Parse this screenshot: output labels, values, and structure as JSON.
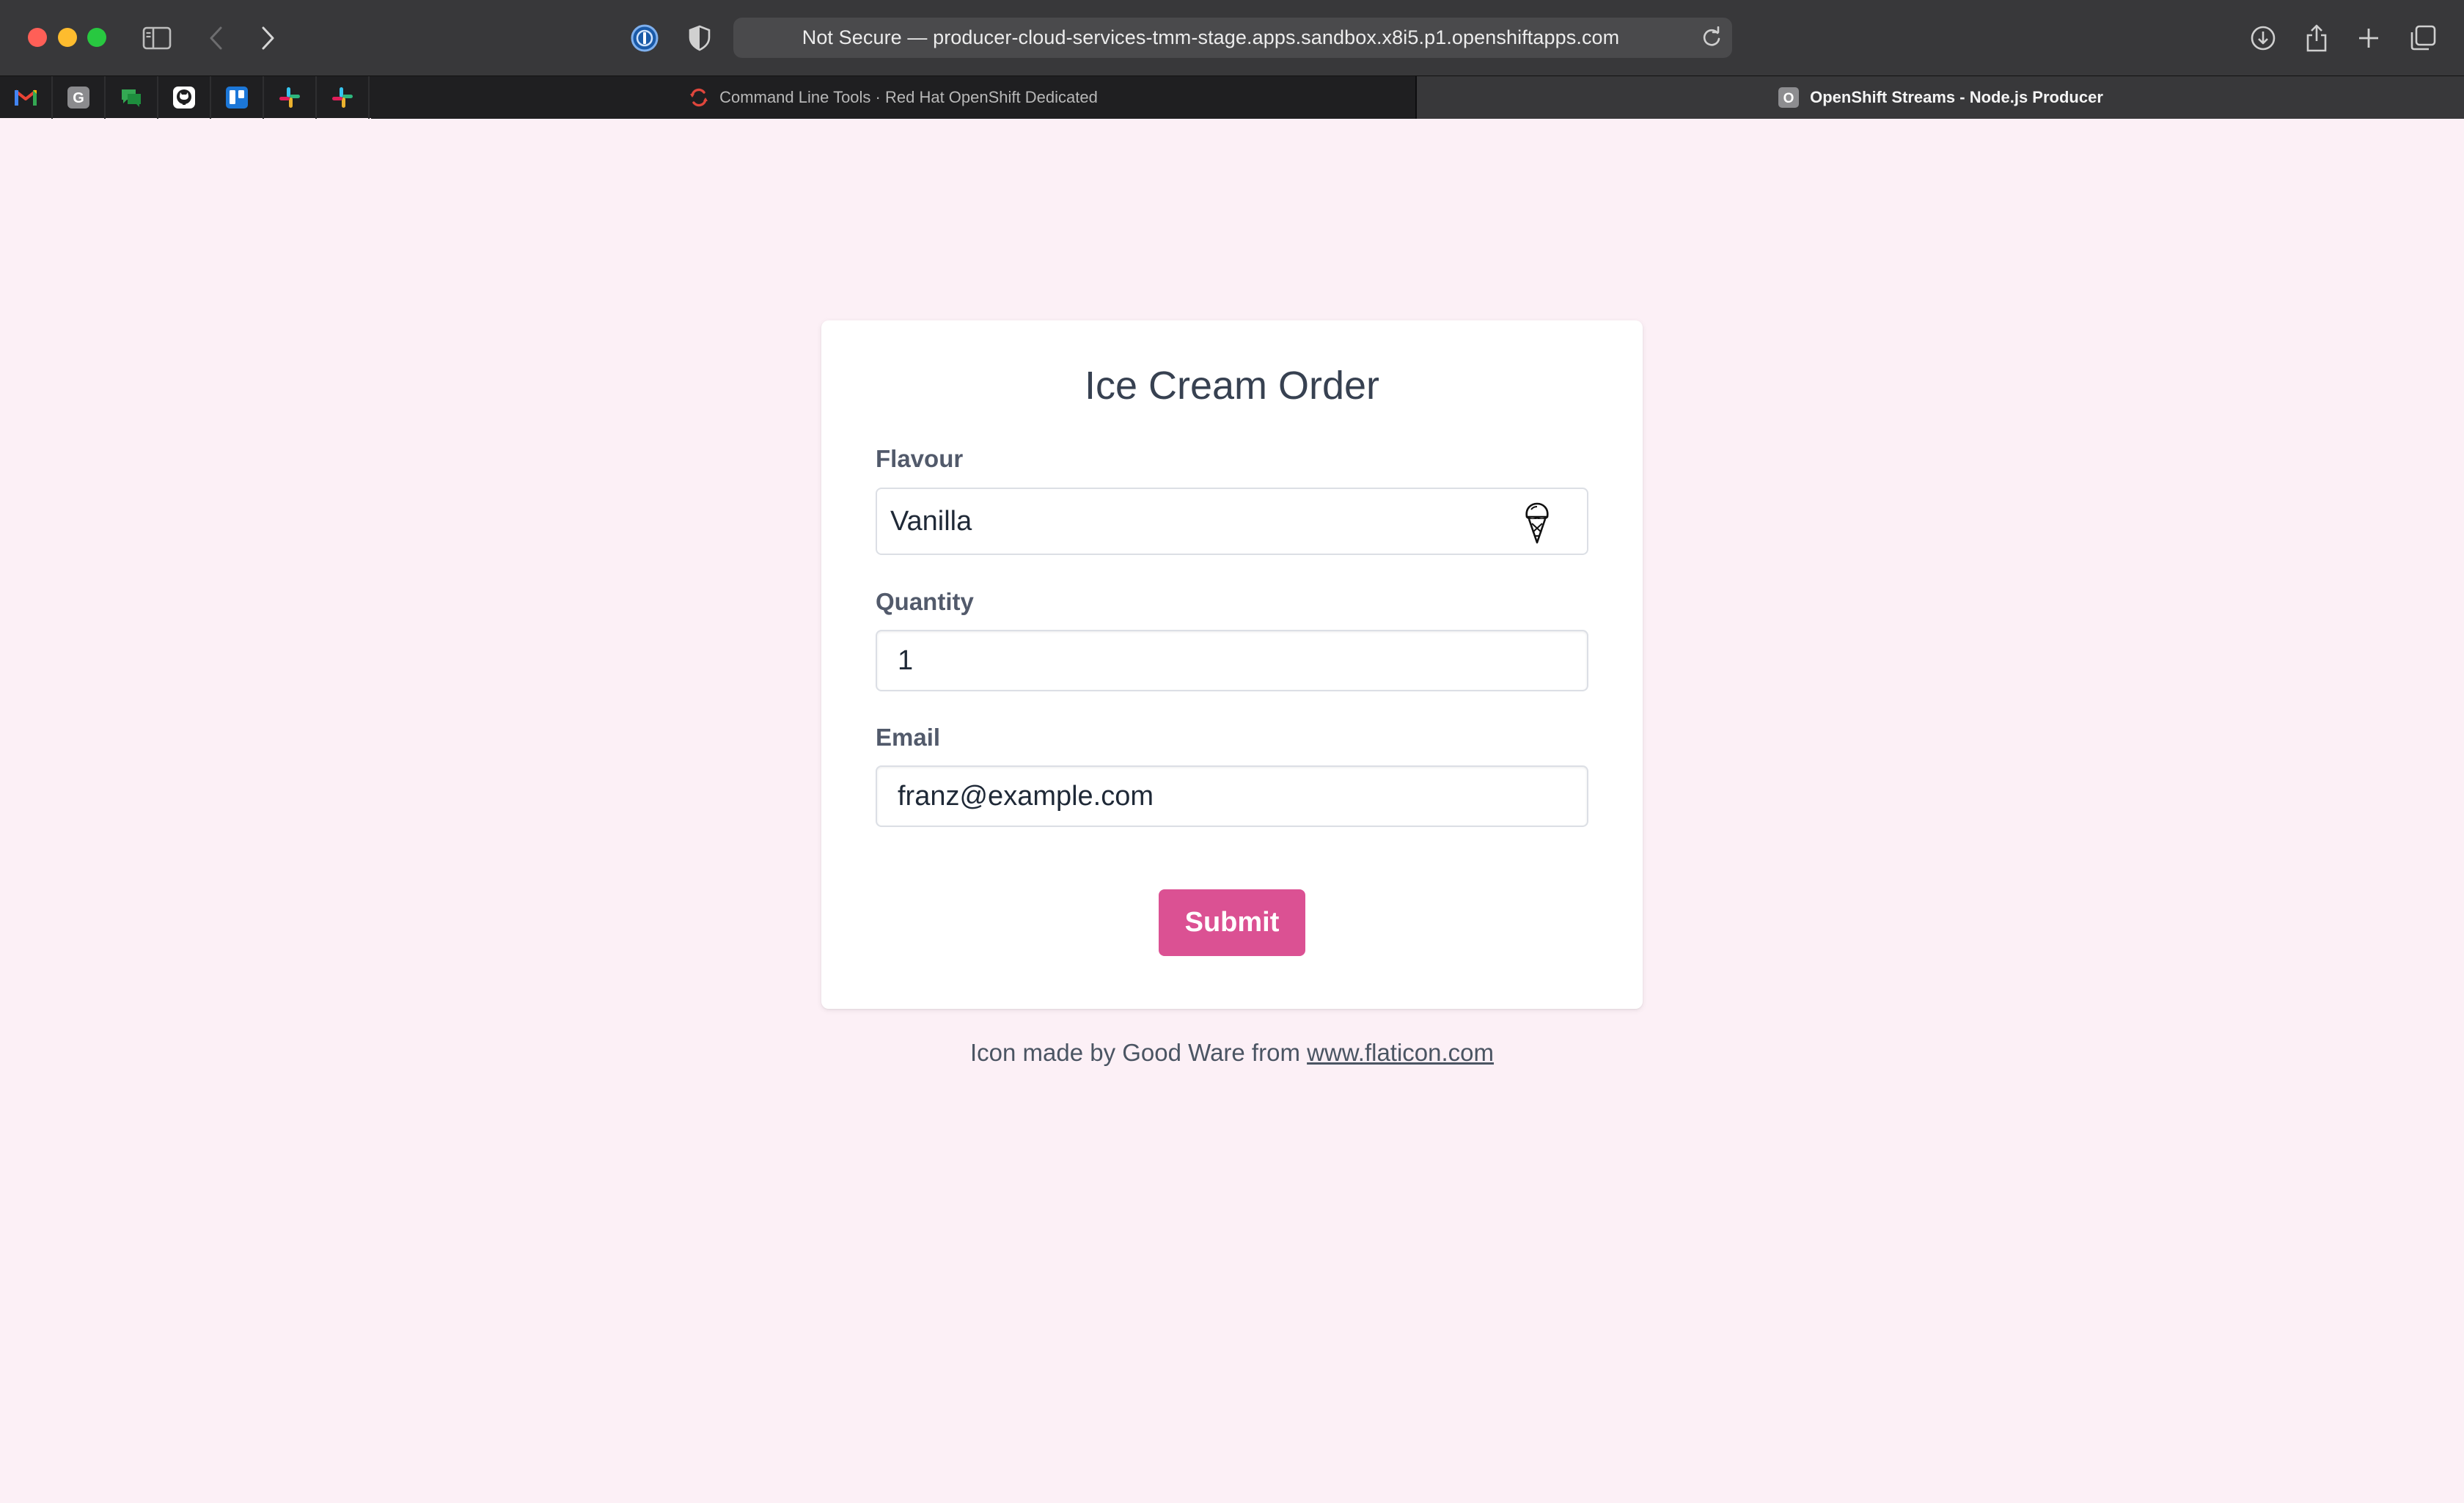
{
  "browser": {
    "address_text": "Not Secure — producer-cloud-services-tmm-stage.apps.sandbox.x8i5.p1.openshiftapps.com",
    "tabs": [
      {
        "label": "Command Line Tools · Red Hat OpenShift Dedicated",
        "active": false,
        "icon": "openshift-icon"
      },
      {
        "label": "OpenShift Streams - Node.js Producer",
        "active": true,
        "icon": "letter-o-icon",
        "icon_letter": "O"
      }
    ],
    "bookmarks": [
      {
        "name": "gmail",
        "icon": "gmail-icon"
      },
      {
        "name": "grammarly",
        "icon": "letter-g-icon",
        "icon_letter": "G"
      },
      {
        "name": "chat",
        "icon": "chat-icon"
      },
      {
        "name": "github",
        "icon": "github-icon"
      },
      {
        "name": "trello",
        "icon": "trello-icon"
      },
      {
        "name": "slack",
        "icon": "slack-icon"
      },
      {
        "name": "slack-2",
        "icon": "slack-icon"
      }
    ]
  },
  "form": {
    "title": "Ice Cream Order",
    "flavour": {
      "label": "Flavour",
      "value": "Vanilla",
      "icon": "ice-cream-cone-icon"
    },
    "quantity": {
      "label": "Quantity",
      "value": "1"
    },
    "email": {
      "label": "Email",
      "value": "franz@example.com"
    },
    "submit_label": "Submit"
  },
  "attribution": {
    "prefix": "Icon made by Good Ware from ",
    "link_text": "www.flaticon.com"
  },
  "colors": {
    "page_background": "#fcf0f6",
    "accent": "#db5193"
  }
}
